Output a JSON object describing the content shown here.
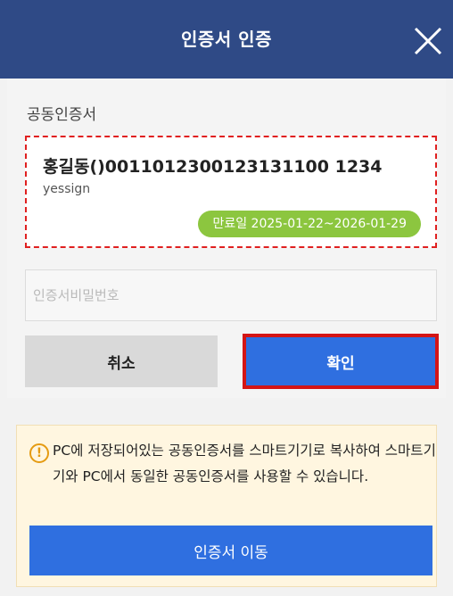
{
  "header": {
    "title": "인증서 인증",
    "close_icon": "close-icon"
  },
  "cert_section": {
    "label": "공동인증서",
    "certificate": {
      "name": "홍길동()0011012300123131100 1234",
      "issuer": "yessign",
      "expiry": "만료일 2025-01-22~2026-01-29"
    }
  },
  "password": {
    "placeholder": "인증서비밀번호",
    "value": ""
  },
  "buttons": {
    "cancel": "취소",
    "confirm": "확인"
  },
  "notice": {
    "icon": "info-icon",
    "text": "PC에 저장되어있는 공동인증서를 스마트기기로 복사하여 스마트기기와 PC에서 동일한 공동인증서를 사용할 수 있습니다.",
    "move_button": "인증서 이동"
  },
  "colors": {
    "header_bg": "#2f4a86",
    "primary_button": "#2f6fe0",
    "highlight_border": "#d41515",
    "badge_green": "#8cc63f",
    "notice_bg": "#fff6e0"
  }
}
